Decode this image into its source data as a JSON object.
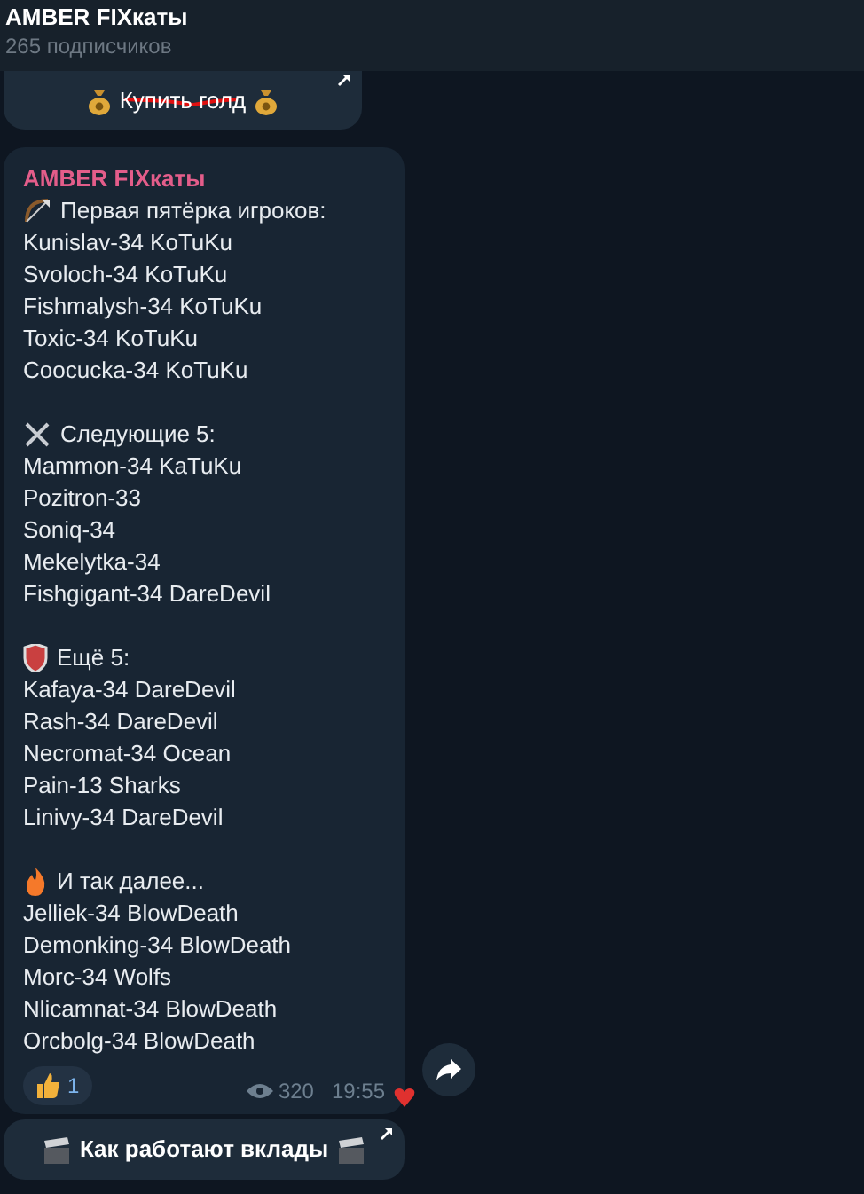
{
  "header": {
    "title": "AMBER FIXкаты",
    "subtitle": "265 подписчиков"
  },
  "top_button": {
    "label": "Купить голд",
    "crossed_out": true
  },
  "post": {
    "author": "AMBER FIXкаты",
    "sections": [
      {
        "kind": "bow",
        "heading": "Первая пятёрка игроков:",
        "lines": [
          "Kunislav-34 KoTuKu",
          "Svoloch-34 KoTuKu",
          "Fishmalysh-34 KoTuKu",
          "Toxic-34 KoTuKu",
          "Coocucka-34 KoTuKu"
        ]
      },
      {
        "kind": "swords",
        "heading": "Следующие 5:",
        "lines": [
          "Mammon-34 KaTuKu",
          "Pozitron-33",
          "Soniq-34",
          "Mekelytka-34",
          "Fishgigant-34 DareDevil"
        ]
      },
      {
        "kind": "shield",
        "heading": "Ещё 5:",
        "lines": [
          "Kafaya-34 DareDevil",
          "Rash-34 DareDevil",
          "Necromat-34 Ocean",
          "Pain-13 Sharks",
          "Linivy-34 DareDevil"
        ]
      },
      {
        "kind": "fire",
        "heading": "И так далее...",
        "lines": [
          "Jelliek-34 BlowDeath",
          "Demonking-34 BlowDeath",
          "Morc-34 Wolfs",
          "Nlicamnat-34 BlowDeath",
          "Orcbolg-34 BlowDeath"
        ]
      }
    ],
    "reaction": {
      "count": "1"
    },
    "views": "320",
    "time": "19:55"
  },
  "bottom_button": {
    "label": "Как работают вклады"
  }
}
